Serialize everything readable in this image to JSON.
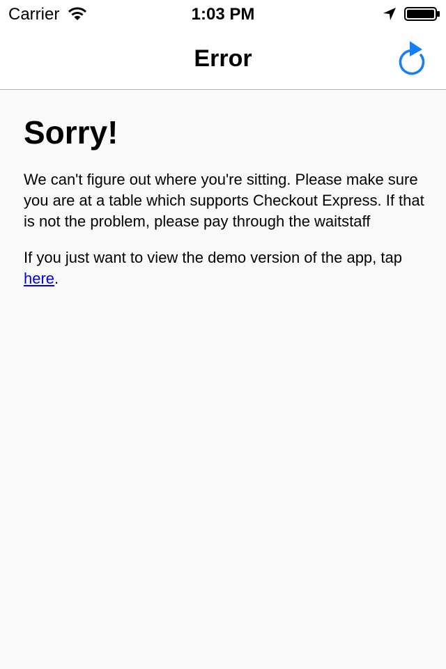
{
  "status_bar": {
    "carrier": "Carrier",
    "time": "1:03 PM",
    "icons": [
      "wifi-icon",
      "location-arrow-icon",
      "battery-icon"
    ]
  },
  "nav_bar": {
    "title": "Error",
    "refresh_icon": "refresh-icon"
  },
  "content": {
    "heading": "Sorry!",
    "message": "We can't figure out where you're sitting. Please make sure you are at a table which supports Checkout Express. If that is not the problem, please pay through the waitstaff",
    "demo_prefix": "If you just want to view the demo version of the app, tap ",
    "demo_link": "here",
    "demo_suffix": "."
  },
  "colors": {
    "accent": "#147efb",
    "link": "#0000ee",
    "background": "#f9f9f9"
  }
}
